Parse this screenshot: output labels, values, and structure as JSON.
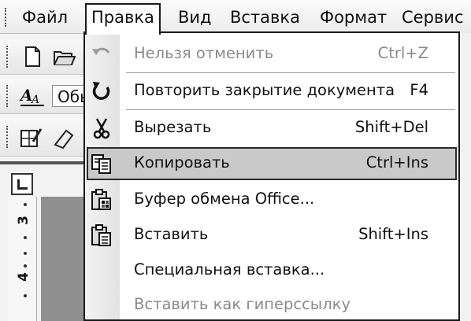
{
  "menubar": {
    "items": [
      {
        "label": "Файл"
      },
      {
        "label": "Правка",
        "active": true
      },
      {
        "label": "Вид"
      },
      {
        "label": "Вставка"
      },
      {
        "label": "Формат"
      },
      {
        "label": "Сервис"
      }
    ]
  },
  "formatting_toolbar": {
    "style_box_value": "Обь"
  },
  "ruler": {
    "numbers": [
      "3",
      "4"
    ]
  },
  "edit_menu": {
    "items": [
      {
        "label": "Нельзя отменить",
        "shortcut": "Ctrl+Z",
        "icon": "undo-icon",
        "state": "disabled"
      },
      {
        "label": "Повторить закрытие документа",
        "shortcut": "F4",
        "icon": "redo-icon",
        "state": "normal"
      },
      {
        "label": "Вырезать",
        "shortcut": "Shift+Del",
        "icon": "scissors-icon",
        "state": "normal"
      },
      {
        "label": "Копировать",
        "shortcut": "Ctrl+Ins",
        "icon": "copy-icon",
        "state": "highlighted"
      },
      {
        "label": "Буфер обмена Office...",
        "shortcut": "",
        "icon": "office-clipboard-icon",
        "state": "normal"
      },
      {
        "label": "Вставить",
        "shortcut": "Shift+Ins",
        "icon": "paste-icon",
        "state": "normal"
      },
      {
        "label": "Специальная вставка...",
        "shortcut": "",
        "icon": "",
        "state": "normal"
      },
      {
        "label": "Вставить как гиперссылку",
        "shortcut": "",
        "icon": "",
        "state": "disabled"
      }
    ]
  }
}
